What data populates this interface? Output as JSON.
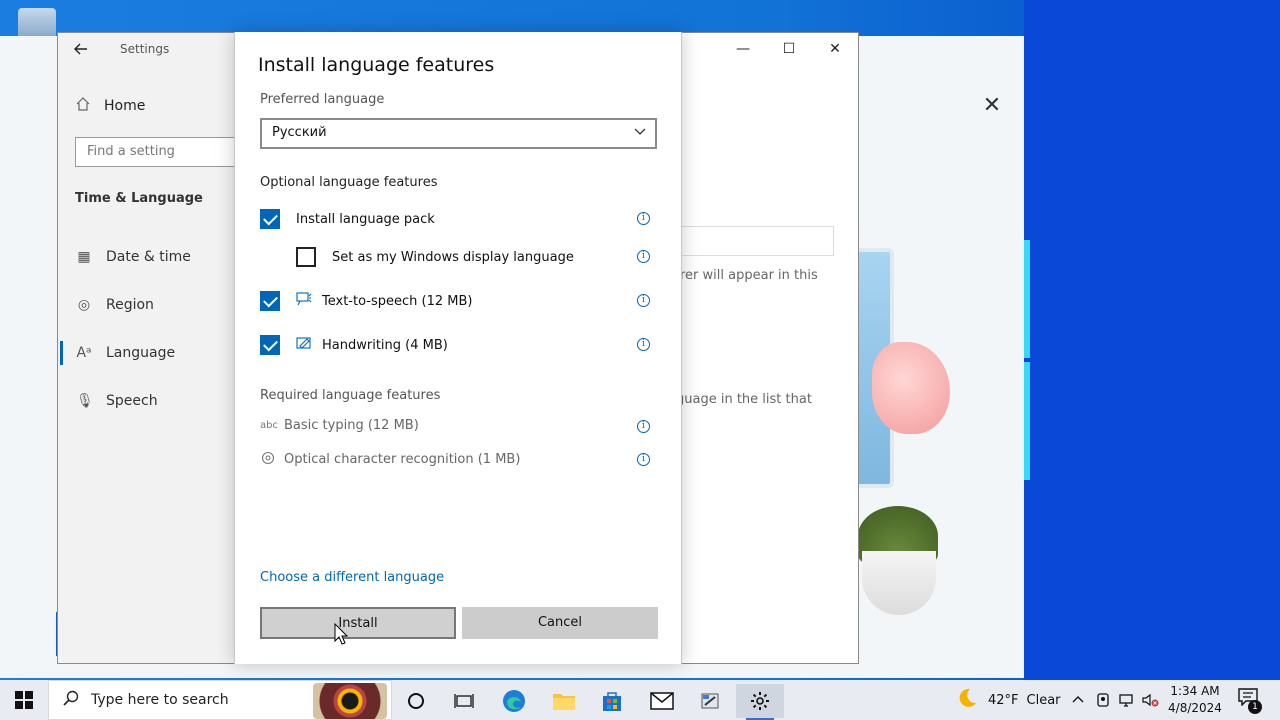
{
  "settings": {
    "window_title": "Settings",
    "nav": {
      "home": "Home",
      "search_placeholder": "Find a setting",
      "section": "Time & Language",
      "items": [
        {
          "label": "Date & time",
          "icon": "calendar-clock-icon"
        },
        {
          "label": "Region",
          "icon": "globe-icon"
        },
        {
          "label": "Language",
          "icon": "language-icon",
          "active": true
        },
        {
          "label": "Speech",
          "icon": "microphone-icon"
        }
      ]
    },
    "background_text": {
      "line1": "rer will appear in this",
      "line2": "guage in the list that"
    }
  },
  "dialog": {
    "title": "Install language features",
    "preferred_label": "Preferred language",
    "preferred_value": "Русский",
    "optional_section": "Optional language features",
    "optional": [
      {
        "label": "Install language pack",
        "checked": true,
        "icon": ""
      },
      {
        "label": "Set as my Windows display language",
        "checked": false,
        "icon": ""
      },
      {
        "label": "Text-to-speech (12 MB)",
        "checked": true,
        "icon": "speech-icon"
      },
      {
        "label": "Handwriting (4 MB)",
        "checked": true,
        "icon": "handwriting-icon"
      }
    ],
    "required_section": "Required language features",
    "required": [
      {
        "label": "Basic typing (12 MB)",
        "icon": "abc-icon"
      },
      {
        "label": "Optical character recognition (1 MB)",
        "icon": "ocr-icon"
      }
    ],
    "link": "Choose a different language",
    "install_button": "Install",
    "cancel_button": "Cancel"
  },
  "taskbar": {
    "search_placeholder": "Type here to search",
    "weather_temp": "42°F",
    "weather_cond": "Clear",
    "time": "1:34 AM",
    "date": "4/8/2024",
    "notifications": "1"
  }
}
